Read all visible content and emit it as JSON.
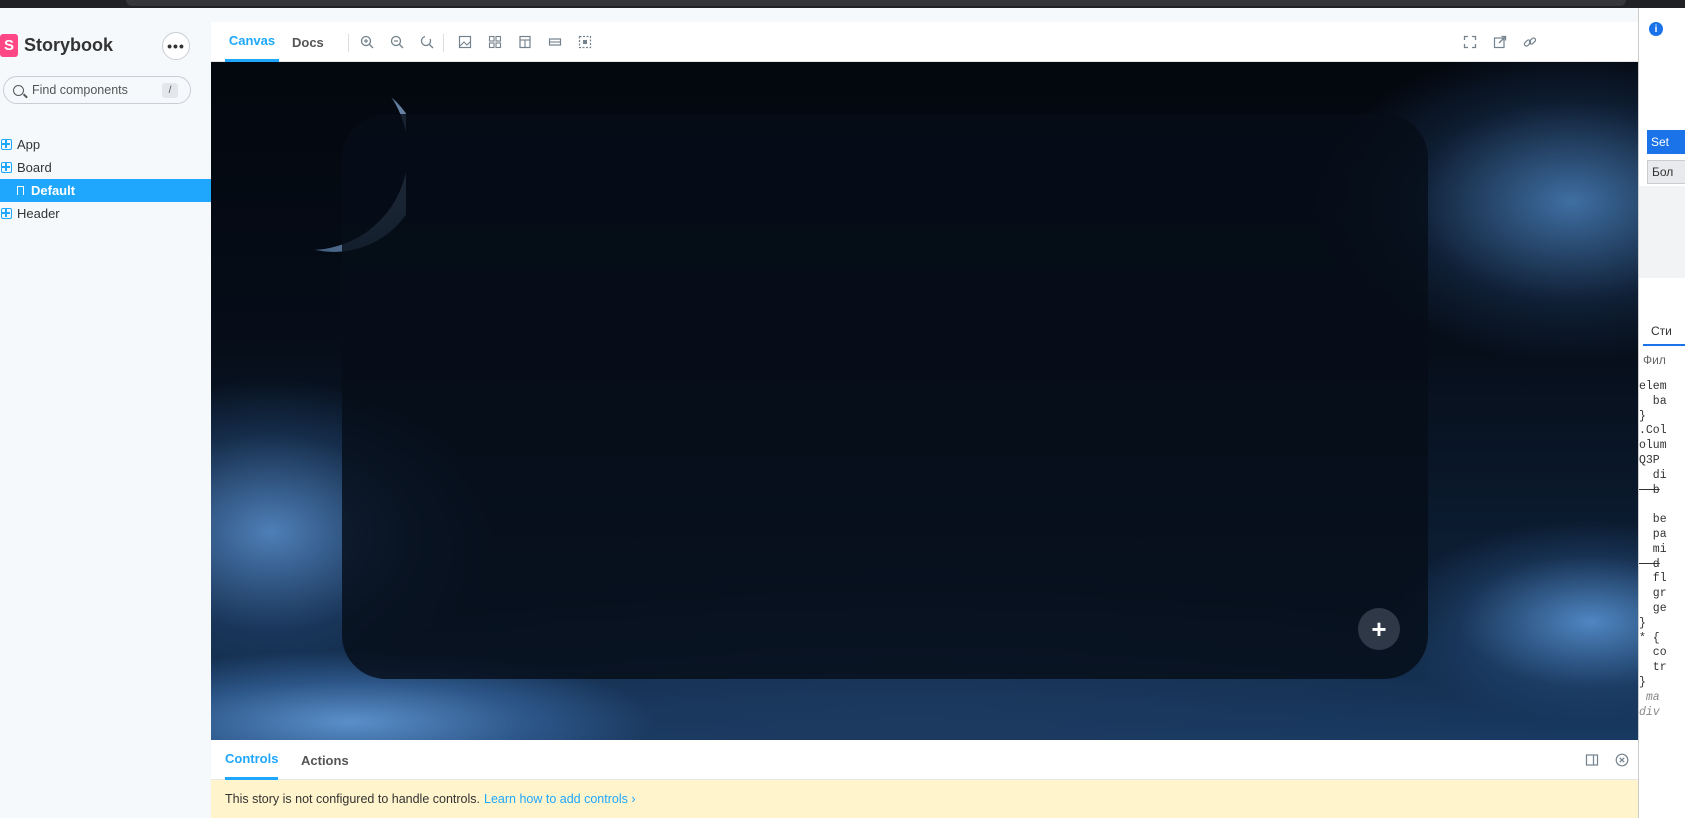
{
  "sidebar": {
    "brand": "Storybook",
    "more_label": "•••",
    "search_placeholder": "Find components",
    "search_shortcut": "/",
    "items": [
      {
        "label": "App"
      },
      {
        "label": "Board"
      },
      {
        "label": "Default"
      },
      {
        "label": "Header"
      }
    ]
  },
  "toolbar": {
    "tabs": [
      {
        "label": "Canvas"
      },
      {
        "label": "Docs"
      }
    ]
  },
  "canvas": {
    "add_button": "+"
  },
  "addons": {
    "tabs": [
      {
        "label": "Controls"
      },
      {
        "label": "Actions"
      }
    ],
    "notice_text": "This story is not configured to handle controls.",
    "notice_link": "Learn how to add controls ›"
  },
  "devtools": {
    "info": "i",
    "btn_primary": "Set",
    "btn_secondary": "Бол",
    "styles_tab": "Сти",
    "filter_label": "Фил",
    "code_lines": [
      "elem",
      "  ba",
      "}",
      ".Col",
      "olum",
      "Q3P",
      "  di",
      "  b",
      "",
      "  be",
      "  pa",
      "  mi",
      "  d",
      "  fl",
      "  gr",
      "  ge",
      "}",
      "* {",
      "  co",
      "  tr",
      "}",
      " ma",
      "div"
    ]
  },
  "colors": {
    "accent": "#1ea7fd",
    "brand_pink": "#ff4785",
    "notice_bg": "#fff4cc"
  }
}
